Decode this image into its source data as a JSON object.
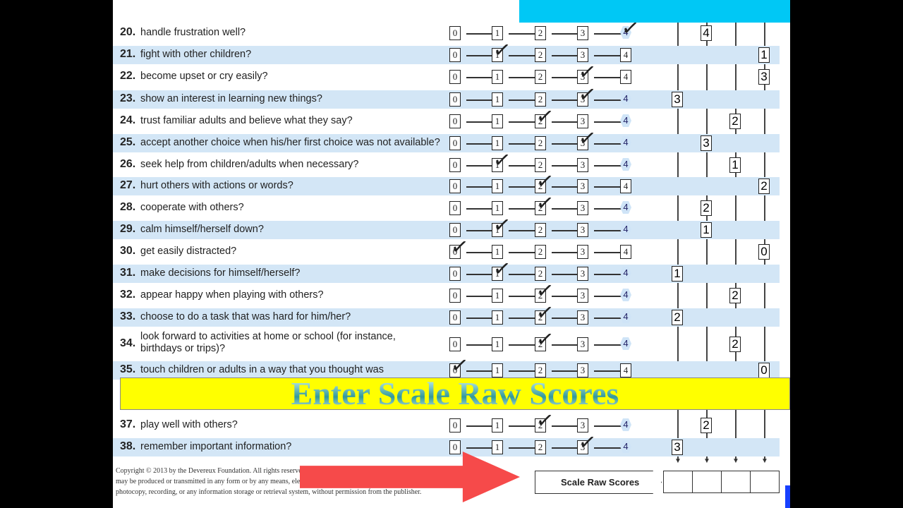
{
  "items": [
    {
      "num": "20.",
      "text": "handle frustration well?",
      "check": 4,
      "hex4": true,
      "score_col": 1,
      "score": "4"
    },
    {
      "num": "21.",
      "text": "fight with other children?",
      "check": 1,
      "hex4": false,
      "score_col": 3,
      "score": "1"
    },
    {
      "num": "22.",
      "text": "become upset or cry easily?",
      "check": 3,
      "hex4": false,
      "score_col": 3,
      "score": "3"
    },
    {
      "num": "23.",
      "text": "show an interest in learning new things?",
      "check": 3,
      "hex4": true,
      "score_col": 0,
      "score": "3"
    },
    {
      "num": "24.",
      "text": "trust familiar adults and believe what they say?",
      "check": 2,
      "hex4": true,
      "score_col": 2,
      "score": "2"
    },
    {
      "num": "25.",
      "text": "accept another choice when his/her first choice was not available?",
      "check": 3,
      "hex4": true,
      "score_col": 1,
      "score": "3"
    },
    {
      "num": "26.",
      "text": "seek help from children/adults when necessary?",
      "check": 1,
      "hex4": true,
      "score_col": 2,
      "score": "1"
    },
    {
      "num": "27.",
      "text": "hurt others with actions or words?",
      "check": 2,
      "hex4": false,
      "score_col": 3,
      "score": "2"
    },
    {
      "num": "28.",
      "text": "cooperate with others?",
      "check": 2,
      "hex4": true,
      "score_col": 1,
      "score": "2"
    },
    {
      "num": "29.",
      "text": "calm himself/herself down?",
      "check": 1,
      "hex4": true,
      "score_col": 1,
      "score": "1"
    },
    {
      "num": "30.",
      "text": "get easily distracted?",
      "check": 0,
      "hex4": false,
      "score_col": 3,
      "score": "0"
    },
    {
      "num": "31.",
      "text": "make decisions for himself/herself?",
      "check": 1,
      "hex4": true,
      "score_col": 0,
      "score": "1"
    },
    {
      "num": "32.",
      "text": "appear happy when playing with others?",
      "check": 2,
      "hex4": true,
      "score_col": 2,
      "score": "2"
    },
    {
      "num": "33.",
      "text": "choose to do a task that was hard for him/her?",
      "check": 2,
      "hex4": true,
      "score_col": 0,
      "score": "2"
    },
    {
      "num": "34.",
      "text": "look forward to activities at home or school (for instance, birthdays or trips)?",
      "check": 2,
      "hex4": true,
      "score_col": 2,
      "score": "2"
    },
    {
      "num": "35.",
      "text": "touch children or adults in a way that you thought was",
      "check": 0,
      "hex4": false,
      "score_col": 3,
      "score": "0"
    },
    {
      "num": "37.",
      "text": "play well with others?",
      "check": 2,
      "hex4": true,
      "score_col": 1,
      "score": "2"
    },
    {
      "num": "38.",
      "text": "remember important information?",
      "check": 3,
      "hex4": true,
      "score_col": 0,
      "score": "3"
    }
  ],
  "options": [
    "0",
    "1",
    "2",
    "3",
    "4"
  ],
  "banner": "Enter Scale Raw Scores",
  "copyright": [
    "Copyright © 2013 by the Devereux Foundation. All rights reserved.",
    "may be produced or transmitted in any form or by any means, electro",
    "photocopy, recording, or any information storage or retrieval system, without permission from the publisher."
  ],
  "scale_raw_scores_label": "Scale Raw Scores",
  "colors": {
    "stripe": "#d3e6f6",
    "banner": "#ffff00",
    "arrow": "#f64a4a",
    "cyan": "#00c8f5"
  }
}
